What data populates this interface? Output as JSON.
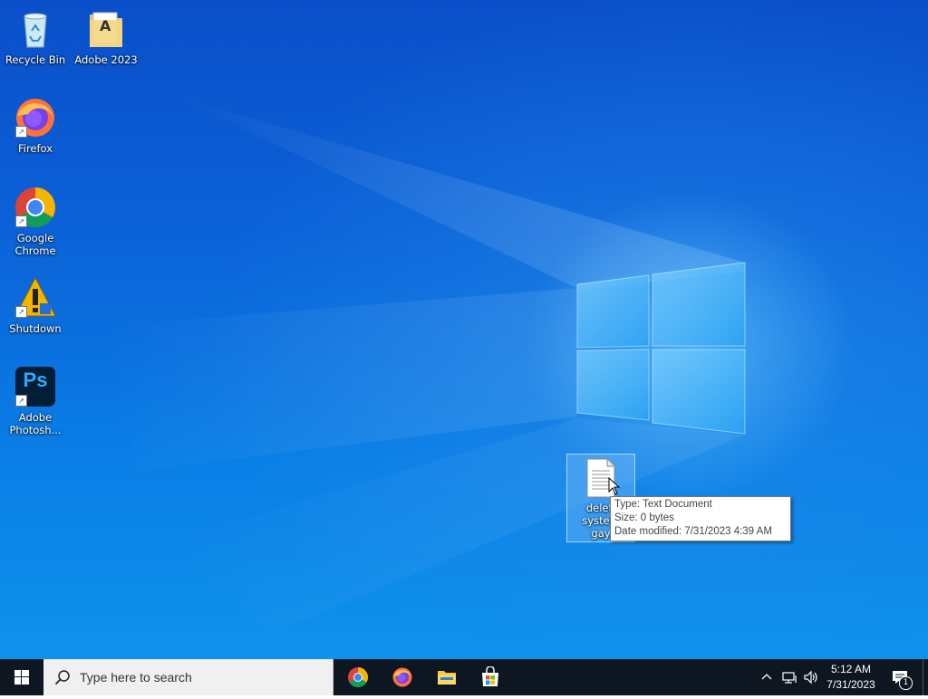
{
  "desktop": {
    "icons": [
      {
        "label": "Recycle Bin",
        "icon": "recycle-bin-icon"
      },
      {
        "label": "Adobe 2023",
        "icon": "folder-icon"
      },
      {
        "label": "Firefox",
        "icon": "firefox-icon"
      },
      {
        "label": "Google Chrome",
        "icon": "chrome-icon"
      },
      {
        "label": "Shutdown",
        "icon": "shutdown-icon"
      },
      {
        "label": "Adobe Photosh...",
        "icon": "photoshop-icon"
      }
    ],
    "selected_file": {
      "label": "deleti system gay",
      "icon": "text-document-icon"
    },
    "tooltip": {
      "type_line": "Type: Text Document",
      "size_line": "Size: 0 bytes",
      "modified_line": "Date modified: 7/31/2023 4:39 AM"
    },
    "folder_badge_letter": "A",
    "photoshop_letters": "Ps"
  },
  "taskbar": {
    "search_placeholder": "Type here to search",
    "pinned": [
      "chrome-icon",
      "firefox-icon",
      "file-explorer-icon",
      "store-icon"
    ],
    "clock_time": "5:12 AM",
    "clock_date": "7/31/2023",
    "notification_count": "1"
  },
  "colors": {
    "taskbar": "#0e1621",
    "desktop_top": "#0a4fc9",
    "desktop_bottom": "#0e92ec",
    "selection": "#8cc8ff"
  }
}
